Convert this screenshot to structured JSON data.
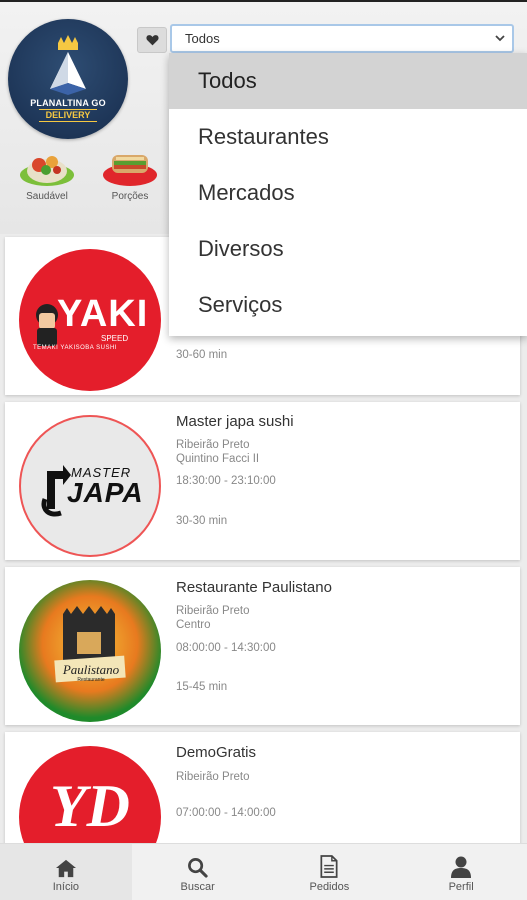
{
  "header": {
    "logo_text_line1": "PLANALTINA GO",
    "logo_text_line2": "DELIVERY",
    "favorite_icon": "heart-icon",
    "filter_select": {
      "selected": "Todos"
    }
  },
  "categories": [
    {
      "label": "Saudável",
      "icon": "salad-icon"
    },
    {
      "label": "Porções",
      "icon": "sandwich-icon"
    }
  ],
  "dropdown": {
    "options": [
      "Todos",
      "Restaurantes",
      "Mercados",
      "Diversos",
      "Serviços"
    ],
    "selected_index": 0
  },
  "restaurants": [
    {
      "logo_text": "YAKI",
      "logo_subtext": "SPEED",
      "logo_caption": "TEMAKI  YAKISOBA  SUSHI",
      "delivery_time": "30-60 min"
    },
    {
      "name": "Master japa sushi",
      "city": "Ribeirão Preto",
      "district": "Quintino Facci II",
      "hours": "18:30:00 - 23:10:00",
      "delivery_time": "30-30 min",
      "logo_text_top": "MASTER",
      "logo_text": "JAPA"
    },
    {
      "name": "Restaurante Paulistano",
      "city": "Ribeirão Preto",
      "district": "Centro",
      "hours": "08:00:00 - 14:30:00",
      "delivery_time": "15-45 min",
      "logo_text": "Paulistano",
      "logo_subtext": "Restaurante"
    },
    {
      "name": "DemoGratis",
      "city": "Ribeirão Preto",
      "hours": "07:00:00 - 14:00:00",
      "logo_text": "YD"
    }
  ],
  "bottom_nav": [
    {
      "label": "Início",
      "icon": "home-icon"
    },
    {
      "label": "Buscar",
      "icon": "search-icon"
    },
    {
      "label": "Pedidos",
      "icon": "document-icon"
    },
    {
      "label": "Perfil",
      "icon": "user-icon"
    }
  ],
  "colors": {
    "accent_border": "#a9c8e8",
    "yaki_red": "#e41e2b",
    "paulistano_green": "#1f8a2a"
  }
}
